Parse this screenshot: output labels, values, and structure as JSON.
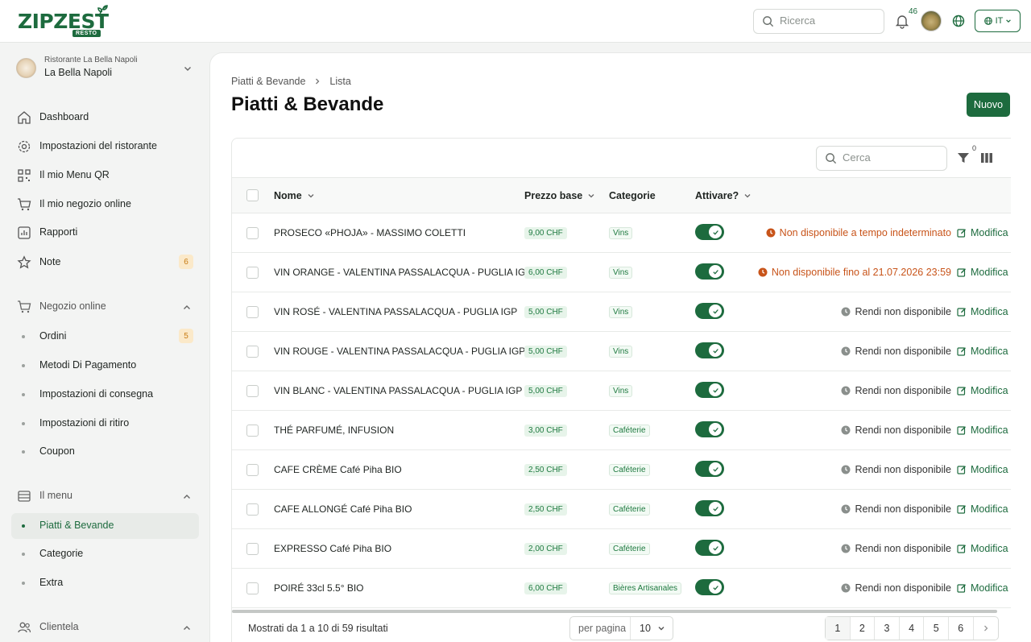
{
  "brand": {
    "name": "ZIPZEST",
    "badge": "RESTO"
  },
  "topbar": {
    "search_placeholder": "Ricerca",
    "notifications_count": "46",
    "language": "IT"
  },
  "sidebar": {
    "restaurant_label": "Ristorante La Bella Napoli",
    "restaurant_name": "La Bella Napoli",
    "main_items": [
      {
        "label": "Dashboard",
        "icon": "home-icon"
      },
      {
        "label": "Impostazioni del ristorante",
        "icon": "gear-icon"
      },
      {
        "label": "Il mio Menu QR",
        "icon": "qr-icon"
      },
      {
        "label": "Il mio negozio online",
        "icon": "cart-icon"
      },
      {
        "label": "Rapporti",
        "icon": "chart-icon"
      },
      {
        "label": "Note",
        "icon": "star-icon",
        "badge": "6"
      }
    ],
    "shop_section": {
      "label": "Negozio online",
      "items": [
        {
          "label": "Ordini",
          "badge": "5"
        },
        {
          "label": "Metodi Di Pagamento"
        },
        {
          "label": "Impostazioni di consegna"
        },
        {
          "label": "Impostazioni di ritiro"
        },
        {
          "label": "Coupon"
        }
      ]
    },
    "menu_section": {
      "label": "Il menu",
      "items": [
        {
          "label": "Piatti & Bevande"
        },
        {
          "label": "Categorie"
        },
        {
          "label": "Extra"
        }
      ]
    },
    "clients_section": {
      "label": "Clientela"
    }
  },
  "main": {
    "breadcrumb": [
      "Piatti & Bevande",
      "Lista"
    ],
    "title": "Piatti & Bevande",
    "new_button": "Nuovo",
    "table_search_placeholder": "Cerca",
    "filter_count": "0",
    "columns": {
      "name": "Nome",
      "price": "Prezzo base",
      "category": "Categorie",
      "active": "Attivare?"
    },
    "edit_label": "Modifica",
    "rows": [
      {
        "name": "PROSECO «PHOJA» - MASSIMO COLETTI",
        "price": "9,00 CHF",
        "category": "Vins",
        "active": true,
        "status": "Non disponibile a tempo indeterminato",
        "status_type": "warn"
      },
      {
        "name": "VIN ORANGE - VALENTINA PASSALACQUA - PUGLIA IGP",
        "price": "6,00 CHF",
        "category": "Vins",
        "active": true,
        "status": "Non disponibile fino al 21.07.2026 23:59",
        "status_type": "warn"
      },
      {
        "name": "VIN ROSÉ - VALENTINA PASSALACQUA - PUGLIA IGP",
        "price": "5,00 CHF",
        "category": "Vins",
        "active": true,
        "status": "Rendi non disponibile",
        "status_type": "normal"
      },
      {
        "name": "VIN ROUGE - VALENTINA PASSALACQUA - PUGLIA IGP",
        "price": "5,00 CHF",
        "category": "Vins",
        "active": true,
        "status": "Rendi non disponibile",
        "status_type": "normal"
      },
      {
        "name": "VIN BLANC - VALENTINA PASSALACQUA - PUGLIA IGP",
        "price": "5,00 CHF",
        "category": "Vins",
        "active": true,
        "status": "Rendi non disponibile",
        "status_type": "normal"
      },
      {
        "name": "THÉ PARFUMÉ, INFUSION",
        "price": "3,00 CHF",
        "category": "Caféterie",
        "active": true,
        "status": "Rendi non disponibile",
        "status_type": "normal"
      },
      {
        "name": "CAFE CRÈME Café Piha BIO",
        "price": "2,50 CHF",
        "category": "Caféterie",
        "active": true,
        "status": "Rendi non disponibile",
        "status_type": "normal"
      },
      {
        "name": "CAFE ALLONGÉ Café Piha BIO",
        "price": "2,50 CHF",
        "category": "Caféterie",
        "active": true,
        "status": "Rendi non disponibile",
        "status_type": "normal"
      },
      {
        "name": "EXPRESSO Café Piha BIO",
        "price": "2,00 CHF",
        "category": "Caféterie",
        "active": true,
        "status": "Rendi non disponibile",
        "status_type": "normal"
      },
      {
        "name": "POIRÉ 33cl 5.5° BIO",
        "price": "6,00 CHF",
        "category": "Bières Artisanales",
        "active": true,
        "status": "Rendi non disponibile",
        "status_type": "normal"
      }
    ],
    "footer": {
      "results_text": "Mostrati da 1 a 10 di 59 risultati",
      "per_page_label": "per pagina",
      "per_page_value": "10",
      "pages": [
        "1",
        "2",
        "3",
        "4",
        "5",
        "6"
      ],
      "current_page": "1"
    }
  },
  "colors": {
    "brand": "#1d6b3e",
    "warn": "#c8541a",
    "badge_bg": "#fbe9c9"
  }
}
